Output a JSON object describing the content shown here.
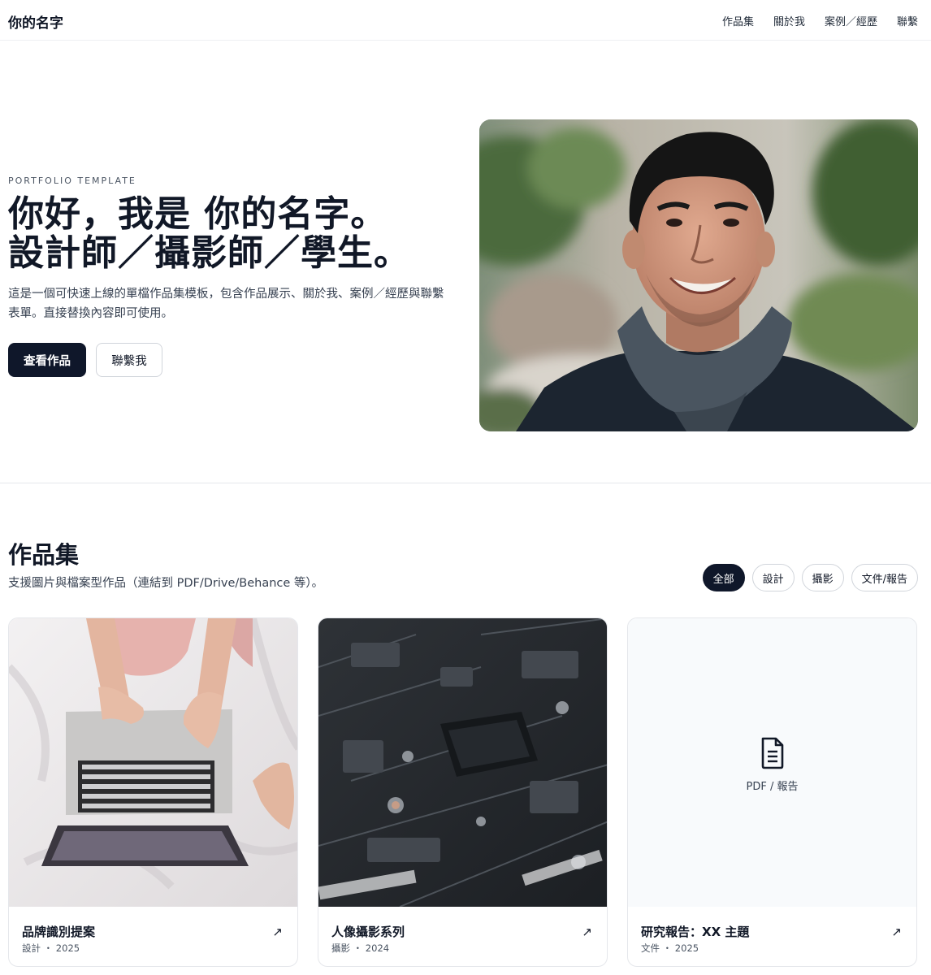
{
  "header": {
    "brand": "你的名字",
    "nav": [
      "作品集",
      "關於我",
      "案例／經歷",
      "聯繫"
    ]
  },
  "hero": {
    "eyebrow": "PORTFOLIO TEMPLATE",
    "title_line1": "你好，我是 你的名字。",
    "title_line2": "設計師／攝影師／學生。",
    "description": "這是一個可快速上線的單檔作品集模板，包含作品展示、關於我、案例／經歷與聯繫表單。直接替換內容即可使用。",
    "primary_button": "查看作品",
    "secondary_button": "聯繫我"
  },
  "portfolio": {
    "title": "作品集",
    "description": "支援圖片與檔案型作品（連結到 PDF/Drive/Behance 等）。",
    "filters": [
      "全部",
      "設計",
      "攝影",
      "文件/報告"
    ],
    "active_filter": "全部",
    "cards": [
      {
        "title": "品牌識別提案",
        "meta": "設計 ・ 2025",
        "arrow": "↗"
      },
      {
        "title": "人像攝影系列",
        "meta": "攝影 ・ 2024",
        "arrow": "↗"
      },
      {
        "title": "研究報告：XX 主題",
        "meta": "文件 ・ 2025",
        "arrow": "↗",
        "placeholder_label": "PDF / 報告"
      }
    ]
  },
  "icons": {
    "document": "document-icon",
    "external": "arrow-up-right-icon"
  },
  "colors": {
    "primary": "#0f172a",
    "text": "#111827",
    "muted": "#374151",
    "border": "#e5e7eb"
  }
}
